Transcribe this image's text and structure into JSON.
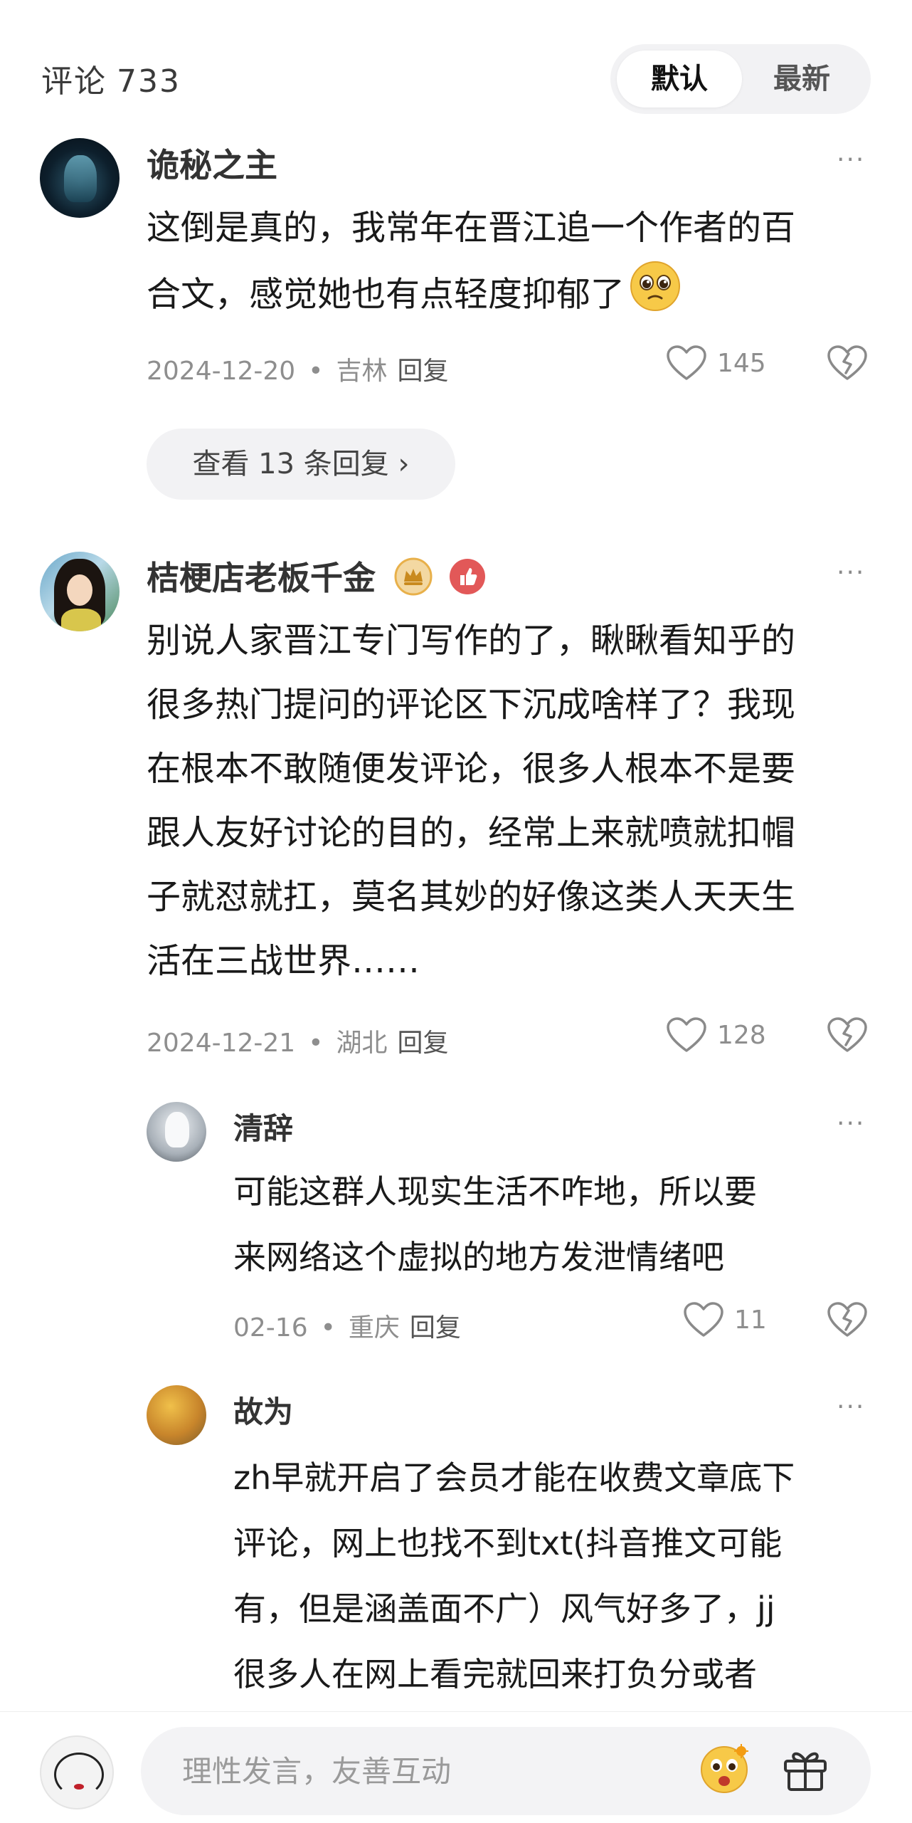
{
  "header": {
    "title": "评论",
    "count": "733",
    "sort": {
      "default_label": "默认",
      "latest_label": "最新"
    }
  },
  "comments": [
    {
      "username": "诡秘之主",
      "content_lines": [
        "这倒是真的，我常年在晋江追一个作者的百",
        "合文，感觉她也有点轻度抑郁了"
      ],
      "date": "2024-12-20",
      "location": "吉林",
      "reply_label": "回复",
      "likes": "145",
      "view_replies": "查看 13 条回复",
      "chevron": "›"
    },
    {
      "username": "桔梗店老板千金",
      "content_lines": [
        "别说人家晋江专门写作的了，瞅瞅看知乎的",
        "很多热门提问的评论区下沉成啥样了？我现",
        "在根本不敢随便发评论，很多人根本不是要",
        "跟人友好讨论的目的，经常上来就喷就扣帽",
        "子就怼就扛，莫名其妙的好像这类人天天生",
        "活在三战世界……"
      ],
      "date": "2024-12-21",
      "location": "湖北",
      "reply_label": "回复",
      "likes": "128",
      "replies": [
        {
          "username": "清辞",
          "content_lines": [
            "可能这群人现实生活不咋地，所以要",
            "来网络这个虚拟的地方发泄情绪吧"
          ],
          "date": "02-16",
          "location": "重庆",
          "reply_label": "回复",
          "likes": "11"
        },
        {
          "username": "故为",
          "content_lines": [
            "zh早就开启了会员才能在收费文章底下",
            "评论，网上也找不到txt(抖音推文可能",
            "有，但是涵盖面不广）风气好多了，jj",
            "很多人在网上看完就回来打负分或者"
          ]
        }
      ]
    }
  ],
  "more_icon": "···",
  "input": {
    "placeholder": "理性发言，友善互动"
  },
  "icons": {
    "like": "heart-outline-icon",
    "dislike": "broken-heart-icon",
    "emoji": "emoji-face-icon",
    "gift": "gift-icon",
    "crown_badge": "crown-badge-icon",
    "thumb_badge": "thumbs-up-badge-icon"
  },
  "colors": {
    "accent_gold": "#e8b04a",
    "accent_red": "#e25858",
    "text_meta": "#8e8e8e",
    "pill_bg": "#f2f2f4"
  }
}
